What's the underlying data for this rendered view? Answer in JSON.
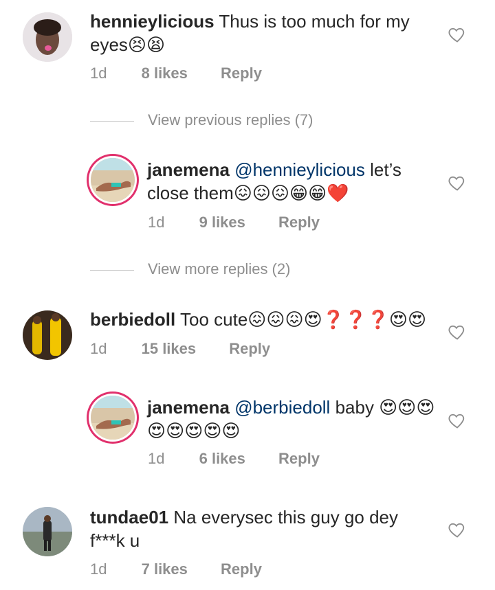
{
  "comments": [
    {
      "username": "hennieylicious",
      "text": "Thus is too much for my eyes😣😫",
      "time": "1d",
      "likes": "8 likes",
      "reply": "Reply"
    },
    {
      "username": "janemena",
      "mention": "@hennieylicious",
      "text": "let’s close them😖😖😖😁😁❤️",
      "time": "1d",
      "likes": "9 likes",
      "reply": "Reply"
    },
    {
      "username": "berbiedoll",
      "text": "Too cute😖😖😖😍❓❓❓😍😍",
      "time": "1d",
      "likes": "15 likes",
      "reply": "Reply"
    },
    {
      "username": "janemena",
      "mention": "@berbiedoll",
      "text": "baby 😍😍😍😍😍😍😍😍",
      "time": "1d",
      "likes": "6 likes",
      "reply": "Reply"
    },
    {
      "username": "tundae01",
      "text": "Na everysec this guy go dey f***k u",
      "time": "1d",
      "likes": "7 likes",
      "reply": "Reply"
    }
  ],
  "view_previous": "View previous replies (7)",
  "view_more": "View more replies (2)",
  "colors": {
    "text": "#262626",
    "meta": "#8e8e8e",
    "mention": "#003569",
    "story_ring": "#e1306c"
  },
  "icons": {
    "like": "heart-outline-icon"
  }
}
